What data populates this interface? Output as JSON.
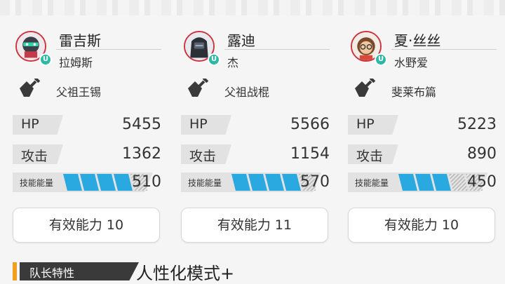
{
  "colors": {
    "energy_fill": "#2aa8e0",
    "energy_empty": "#bdbdbd",
    "badge_teal": "#2fb8a6",
    "avatar_ring": "#cc3340",
    "leader_accent": "#f0a020"
  },
  "operators": [
    {
      "name": "雷吉斯",
      "cv": "拉姆斯",
      "weapon": "父祖王锡",
      "class_badge": "U",
      "hp_label": "HP",
      "hp": "5455",
      "atk_label": "攻击",
      "atk": "1362",
      "energy_label": "技能能量",
      "energy": "510",
      "energy_fill": 0.7,
      "ability": "有效能力 10"
    },
    {
      "name": "露迪",
      "cv": "杰",
      "weapon": "父祖战棍",
      "class_badge": "U",
      "hp_label": "HP",
      "hp": "5566",
      "atk_label": "攻击",
      "atk": "1154",
      "energy_label": "技能能量",
      "energy": "570",
      "energy_fill": 0.8,
      "ability": "有效能力 11"
    },
    {
      "name": "夏·丝丝",
      "cv": "水野爱",
      "weapon": "斐莱布篇",
      "class_badge": "U",
      "hp_label": "HP",
      "hp": "5223",
      "atk_label": "攻击",
      "atk": "890",
      "energy_label": "技能能量",
      "energy": "450",
      "energy_fill": 0.6,
      "ability": "有效能力 10"
    }
  ],
  "leader": {
    "tag": "队长特性",
    "value": "人性化模式+"
  }
}
